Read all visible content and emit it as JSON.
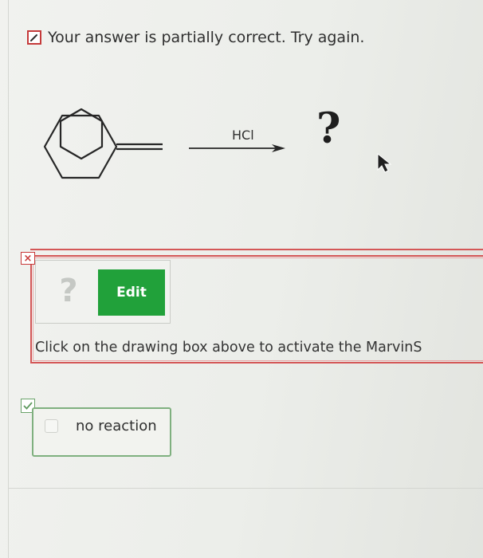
{
  "feedback": {
    "message": "Your answer is partially correct.  Try again.",
    "status_color": "#c53a3a",
    "icon": "pencil-icon"
  },
  "reaction": {
    "reagent": "HCl",
    "product_placeholder": "?",
    "reactant_icon": "methylenecyclohexane-structure-icon"
  },
  "answer": {
    "status": "incorrect",
    "status_icon": "x-icon",
    "status_mark": "×",
    "status_color": "#d45757",
    "drawing_placeholder": "?",
    "edit_label": "Edit",
    "edit_color": "#21a13a",
    "hint": "Click on the drawing box above to activate the MarvinS"
  },
  "no_reaction": {
    "status": "correct",
    "status_icon": "check-icon",
    "label": "no reaction",
    "checked": false
  },
  "cursor": "mouse-pointer-icon"
}
